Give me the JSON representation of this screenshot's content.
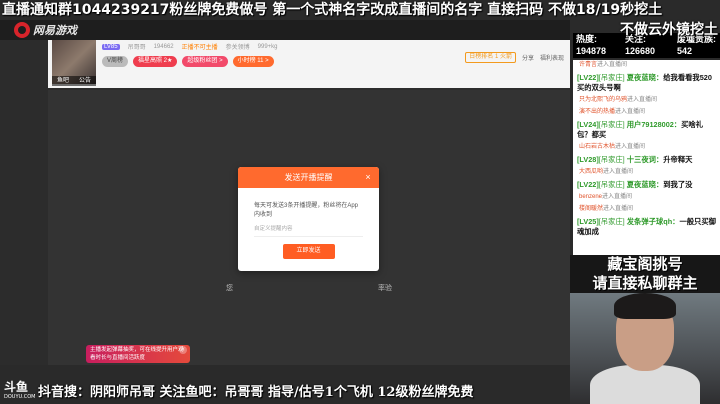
{
  "overlay": {
    "top_line": "直播通知群1044239217粉丝牌免费做号 第一个式神名字改成直播间的名字 直接扫码 不做18/19秒挖土",
    "top_line2": "不做云外镜挖土",
    "bottom_line": "抖音搜：阴阳师吊哥 关注鱼吧：吊哥哥 指导/估号1个飞机 12级粉丝牌免费",
    "promo_line1": "藏宝阁挑号",
    "promo_line2": "请直接私聊群主",
    "watermark": "斗鱼",
    "watermark_sub": "DOUYU.COM"
  },
  "site": {
    "logo_text": "网易游戏"
  },
  "room": {
    "avatar_tabs": [
      "鱼吧",
      "公告"
    ],
    "meta": [
      "LV85",
      "吊哥哥",
      "194662",
      "正播不可主播",
      "参关领博",
      "999+kg"
    ],
    "tags": [
      {
        "label": "V周榜",
        "style": "grey"
      },
      {
        "label": "福星高照 2★",
        "style": "red"
      },
      {
        "label": "超级粉丝团 >",
        "style": "pink"
      },
      {
        "label": "小时榜 11 >",
        "style": "orange"
      }
    ],
    "daily_rank": "日榜排名 1 火箭",
    "share_label": "分享",
    "welfare_label": "福利表现"
  },
  "player": {
    "note_left": "您",
    "note_right": "率验"
  },
  "toast": {
    "text": "主播发起弹幕抽奖，可在线提升用户观看时长与直播间活跃度",
    "close": "×"
  },
  "modal": {
    "title": "发送开播提醒",
    "close": "×",
    "body": "每天可发送3条开播提醒，粉丝将在App内收到",
    "input_placeholder": "自定义提醒内容",
    "button": "立即发送"
  },
  "stats": {
    "labels": [
      "热度:",
      "关注:",
      "废墟贵族:"
    ],
    "values": [
      "194878",
      "126680",
      "542"
    ]
  },
  "chat": [
    {
      "type": "enter",
      "user": "许青言",
      "text": "进入直播间"
    },
    {
      "type": "msg",
      "lvl": "[LV22]",
      "fan": "[吊家庄]",
      "user": "夏夜蓝晓：",
      "msg": "给我看看我520买的双头号啊"
    },
    {
      "type": "enter",
      "user": "只为北熙飞的乌鸦",
      "text": "进入直播间"
    },
    {
      "type": "enter",
      "user": "演不出的热播",
      "text": "进入直播间"
    },
    {
      "type": "msg",
      "lvl": "[LV24]",
      "fan": "[吊家庄]",
      "user": "用户79128002：",
      "msg": "买啥礼包？都买"
    },
    {
      "type": "enter",
      "user": "山石岩古木枯",
      "text": "进入直播间"
    },
    {
      "type": "msg",
      "lvl": "[LV28]",
      "fan": "[吊家庄]",
      "user": "十三夜词：",
      "msg": "升帝释天"
    },
    {
      "type": "enter",
      "user": "大西瓜哟",
      "text": "进入直播间"
    },
    {
      "type": "msg",
      "lvl": "[LV22]",
      "fan": "[吊家庄]",
      "user": "夏夜蓝晓：",
      "msg": "到我了没"
    },
    {
      "type": "enter",
      "user": "benzene",
      "text": "进入直播间"
    },
    {
      "type": "enter",
      "user": "楼阁暖然",
      "text": "进入直播间"
    },
    {
      "type": "msg",
      "lvl": "[LV25]",
      "fan": "[吊家庄]",
      "user": "发条弹子球qh：",
      "msg": "一般只买御魂加成"
    }
  ]
}
